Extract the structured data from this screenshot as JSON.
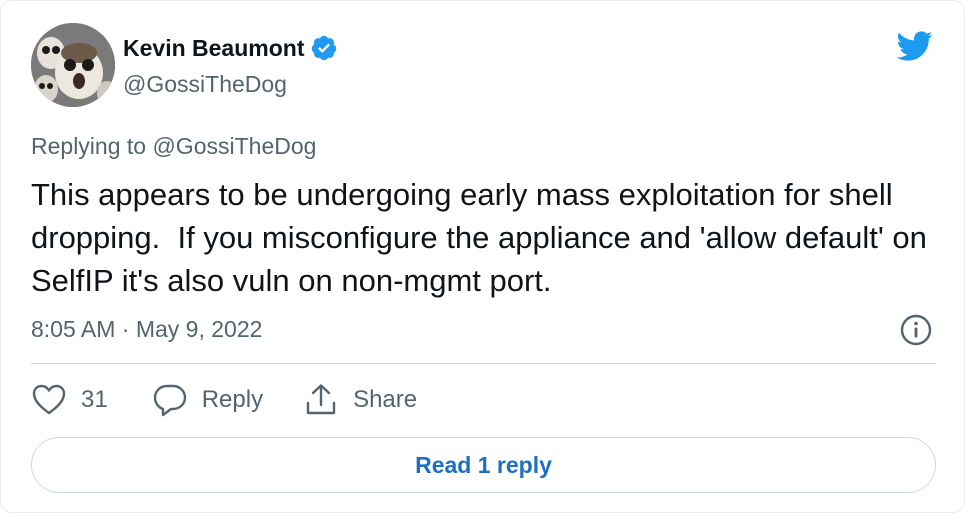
{
  "author": {
    "name": "Kevin Beaumont",
    "handle": "@GossiTheDog",
    "verified": true,
    "avatar_icon": "porg-avatar"
  },
  "brand": {
    "icon": "twitter-bird-icon",
    "color": "#1d9bf0"
  },
  "tweet": {
    "replying_to": "Replying to @GossiTheDog",
    "text": "This appears to be undergoing early mass exploitation for shell dropping.  If you misconfigure the appliance and 'allow default' on SelfIP it's also vuln on non-mgmt port.",
    "timestamp": "8:05 AM · May 9, 2022"
  },
  "actions": {
    "like_count": "31",
    "reply_label": "Reply",
    "share_label": "Share"
  },
  "read_replies_label": "Read 1 reply",
  "colors": {
    "text_primary": "#0f1419",
    "text_secondary": "#536471",
    "link": "#1d6fc2",
    "border": "#cfd9de"
  }
}
